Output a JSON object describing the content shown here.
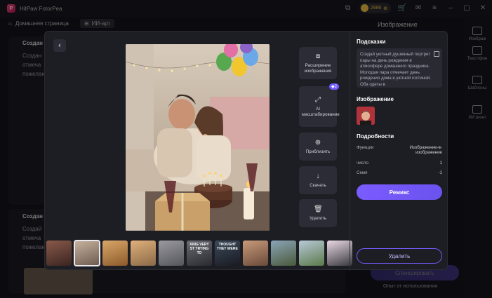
{
  "app": {
    "name": "HitPaw FotorPea"
  },
  "titlebar": {
    "credits": "2886"
  },
  "nav": {
    "home": "Домашняя страница",
    "ai_tab": "ИИ-арт"
  },
  "background": {
    "right_title": "Изображение",
    "create_1": "Создан",
    "create_2": "Создан",
    "generate_btn": "Сгенерировать",
    "footer_note": "Опыт от использования",
    "snippets": [
      "Создан",
      "отмеча",
      "пожелани",
      "Создай",
      "отмеча",
      "пожелани"
    ]
  },
  "sidebar": {
    "items": [
      {
        "label": "Изображ"
      },
      {
        "label": "Текст/фон"
      },
      {
        "label": "Шаблоны"
      },
      {
        "label": "ИИ агент"
      }
    ]
  },
  "modal": {
    "tools": [
      {
        "label": "Расширение изображения",
        "icon": "expand-icon"
      },
      {
        "label": "AI масштабирование",
        "icon": "upscale-icon",
        "badge": "2"
      },
      {
        "label": "Приблизить",
        "icon": "zoom-in-icon"
      },
      {
        "label": "Скачать",
        "icon": "download-icon"
      },
      {
        "label": "Удалить",
        "icon": "trash-icon"
      }
    ],
    "thumbnails": [
      {
        "caption": ""
      },
      {
        "caption": ""
      },
      {
        "caption": ""
      },
      {
        "caption": ""
      },
      {
        "caption": ""
      },
      {
        "caption": "KING VERY ST TRYING TO"
      },
      {
        "caption": "THOUGHT THEY WERE"
      },
      {
        "caption": ""
      },
      {
        "caption": ""
      },
      {
        "caption": ""
      },
      {
        "caption": ""
      }
    ],
    "panel": {
      "hints_title": "Подсказки",
      "prompt": "Создай уютный душевный портрет пары на день рождения в атмосфере домашнего праздника. Молодая пара отмечает день рождения дома в уютной гостиной. Оба одеты в",
      "image_title": "Изображение",
      "details_title": "Подробности",
      "details": [
        {
          "key": "Функции",
          "value": "Изображение-в-изображение"
        },
        {
          "key": "число",
          "value": "1"
        },
        {
          "key": "Семя",
          "value": "-1"
        }
      ],
      "remix": "Ремикс",
      "delete": "Удалить"
    }
  },
  "colors": {
    "accent": "#7a5cff",
    "modal_bg": "#1d1d24",
    "tool_bg": "#2c2c36"
  }
}
